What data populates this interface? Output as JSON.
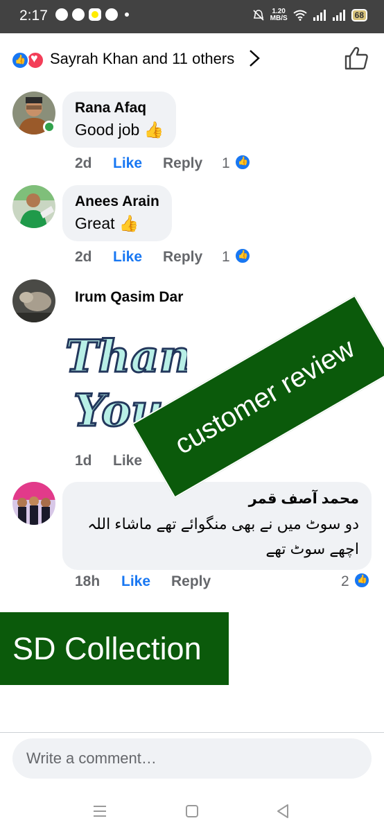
{
  "status_bar": {
    "time": "2:17",
    "net_speed_value": "1.20",
    "net_speed_unit": "MB/S",
    "battery": "68",
    "app_icons": [
      "whatsapp-icon",
      "messenger-icon",
      "snapchat-icon",
      "facebook-icon"
    ]
  },
  "reactions": {
    "summary": "Sayrah Khan and 11 others",
    "icons": [
      "like-reaction-icon",
      "love-reaction-icon"
    ]
  },
  "comments": [
    {
      "author": "Rana Afaq",
      "text": "Good job 👍",
      "time": "2d",
      "like": "Like",
      "reply": "Reply",
      "likes": "1",
      "online": true
    },
    {
      "author": "Anees Arain",
      "text": "Great 👍",
      "time": "2d",
      "like": "Like",
      "reply": "Reply",
      "likes": "1",
      "online": false
    },
    {
      "author": "Irum Qasim Dar",
      "sticker": "Thank You",
      "time": "1d",
      "like": "Like",
      "online": false
    },
    {
      "author": "محمد آصف قمر",
      "text": "دو سوٹ میں نے بھی منگوائے تھے ماشاء اللہ اچھے سوٹ تھے",
      "time": "18h",
      "like": "Like",
      "reply": "Reply",
      "likes": "2",
      "online": false
    }
  ],
  "overlays": {
    "review_banner": "customer review",
    "brand_banner": "SD Collection"
  },
  "composer": {
    "placeholder": "Write a comment…"
  },
  "colors": {
    "facebook_blue": "#1877f2",
    "love_red": "#f33e58",
    "bubble_gray": "#f0f2f5",
    "banner_green": "#0b5a0b",
    "online_green": "#31a24c"
  }
}
